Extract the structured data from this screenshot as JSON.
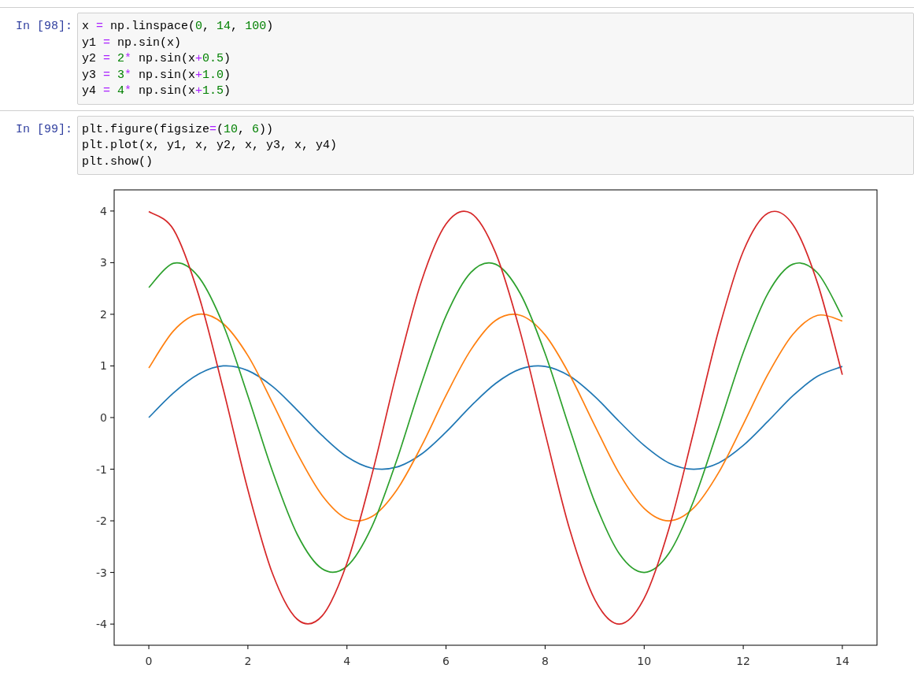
{
  "cells": [
    {
      "prompt": "In [98]:",
      "lines": [
        [
          {
            "text": "x ",
            "kind": "plain"
          },
          {
            "text": "=",
            "kind": "op"
          },
          {
            "text": " np.linspace(",
            "kind": "plain"
          },
          {
            "text": "0",
            "kind": "num"
          },
          {
            "text": ", ",
            "kind": "plain"
          },
          {
            "text": "14",
            "kind": "num"
          },
          {
            "text": ", ",
            "kind": "plain"
          },
          {
            "text": "100",
            "kind": "num"
          },
          {
            "text": ")",
            "kind": "plain"
          }
        ],
        [
          {
            "text": "y1 ",
            "kind": "plain"
          },
          {
            "text": "=",
            "kind": "op"
          },
          {
            "text": " np.sin(x)",
            "kind": "plain"
          }
        ],
        [
          {
            "text": "y2 ",
            "kind": "plain"
          },
          {
            "text": "= ",
            "kind": "op"
          },
          {
            "text": "2",
            "kind": "num"
          },
          {
            "text": "*",
            "kind": "op"
          },
          {
            "text": " np.sin(x",
            "kind": "plain"
          },
          {
            "text": "+",
            "kind": "op"
          },
          {
            "text": "0.5",
            "kind": "num"
          },
          {
            "text": ")",
            "kind": "plain"
          }
        ],
        [
          {
            "text": "y3 ",
            "kind": "plain"
          },
          {
            "text": "= ",
            "kind": "op"
          },
          {
            "text": "3",
            "kind": "num"
          },
          {
            "text": "*",
            "kind": "op"
          },
          {
            "text": " np.sin(x",
            "kind": "plain"
          },
          {
            "text": "+",
            "kind": "op"
          },
          {
            "text": "1.0",
            "kind": "num"
          },
          {
            "text": ")",
            "kind": "plain"
          }
        ],
        [
          {
            "text": "y4 ",
            "kind": "plain"
          },
          {
            "text": "= ",
            "kind": "op"
          },
          {
            "text": "4",
            "kind": "num"
          },
          {
            "text": "*",
            "kind": "op"
          },
          {
            "text": " np.sin(x",
            "kind": "plain"
          },
          {
            "text": "+",
            "kind": "op"
          },
          {
            "text": "1.5",
            "kind": "num"
          },
          {
            "text": ")",
            "kind": "plain"
          }
        ]
      ]
    },
    {
      "prompt": "In [99]:",
      "lines": [
        [
          {
            "text": "plt.figure(figsize",
            "kind": "plain"
          },
          {
            "text": "=",
            "kind": "op"
          },
          {
            "text": "(",
            "kind": "plain"
          },
          {
            "text": "10",
            "kind": "num"
          },
          {
            "text": ", ",
            "kind": "plain"
          },
          {
            "text": "6",
            "kind": "num"
          },
          {
            "text": "))",
            "kind": "plain"
          }
        ],
        [
          {
            "text": "plt.plot(x, y1, x, y2, x, y3, x, y4)",
            "kind": "plain"
          }
        ],
        [
          {
            "text": "plt.show()",
            "kind": "plain"
          }
        ]
      ],
      "output": {
        "chart_data": {
          "type": "line",
          "x": [
            0,
            0.5,
            1,
            1.5,
            2,
            2.5,
            3,
            3.5,
            4,
            4.5,
            5,
            5.5,
            6,
            6.5,
            7,
            7.5,
            8,
            8.5,
            9,
            9.5,
            10,
            10.5,
            11,
            11.5,
            12,
            12.5,
            13,
            13.5,
            14
          ],
          "series": [
            {
              "color": "#1f77b4",
              "values": [
                0,
                0.48,
                0.84,
                1.0,
                0.91,
                0.6,
                0.14,
                -0.35,
                -0.76,
                -0.98,
                -0.96,
                -0.71,
                -0.28,
                0.22,
                0.66,
                0.94,
                0.99,
                0.8,
                0.41,
                -0.08,
                -0.54,
                -0.88,
                -1.0,
                -0.88,
                -0.54,
                -0.07,
                0.42,
                0.8,
                0.99
              ]
            },
            {
              "color": "#ff7f0e",
              "values": [
                0.96,
                1.68,
                2.0,
                1.82,
                1.2,
                0.28,
                -0.7,
                -1.51,
                -1.96,
                -1.92,
                -1.41,
                -0.56,
                0.43,
                1.31,
                1.88,
                1.98,
                1.6,
                0.82,
                -0.15,
                -1.09,
                -1.76,
                -2.0,
                -1.75,
                -1.07,
                -0.13,
                0.84,
                1.61,
                1.98,
                1.87
              ]
            },
            {
              "color": "#2ca02c",
              "values": [
                2.52,
                2.99,
                2.73,
                1.8,
                0.42,
                -1.05,
                -2.27,
                -2.93,
                -2.88,
                -2.12,
                -0.84,
                0.65,
                1.97,
                2.81,
                2.97,
                2.4,
                1.24,
                -0.23,
                -1.63,
                -2.64,
                -3.0,
                -2.63,
                -1.61,
                -0.2,
                1.26,
                2.41,
                2.97,
                2.8,
                1.95
              ]
            },
            {
              "color": "#d62728",
              "values": [
                3.99,
                3.64,
                2.39,
                0.56,
                -1.4,
                -3.03,
                -3.91,
                -3.84,
                -2.82,
                -1.12,
                0.86,
                2.63,
                3.75,
                3.96,
                3.19,
                1.65,
                -0.3,
                -2.18,
                -3.52,
                -4.0,
                -3.5,
                -2.15,
                -0.27,
                1.68,
                3.22,
                3.96,
                3.74,
                2.6,
                0.83
              ]
            }
          ],
          "xlim": [
            -0.7,
            14.7
          ],
          "ylim": [
            -4.41,
            4.41
          ],
          "xticks": [
            0,
            2,
            4,
            6,
            8,
            10,
            12,
            14
          ],
          "yticks": [
            -4,
            -3,
            -2,
            -1,
            0,
            1,
            2,
            3,
            4
          ]
        }
      }
    }
  ]
}
